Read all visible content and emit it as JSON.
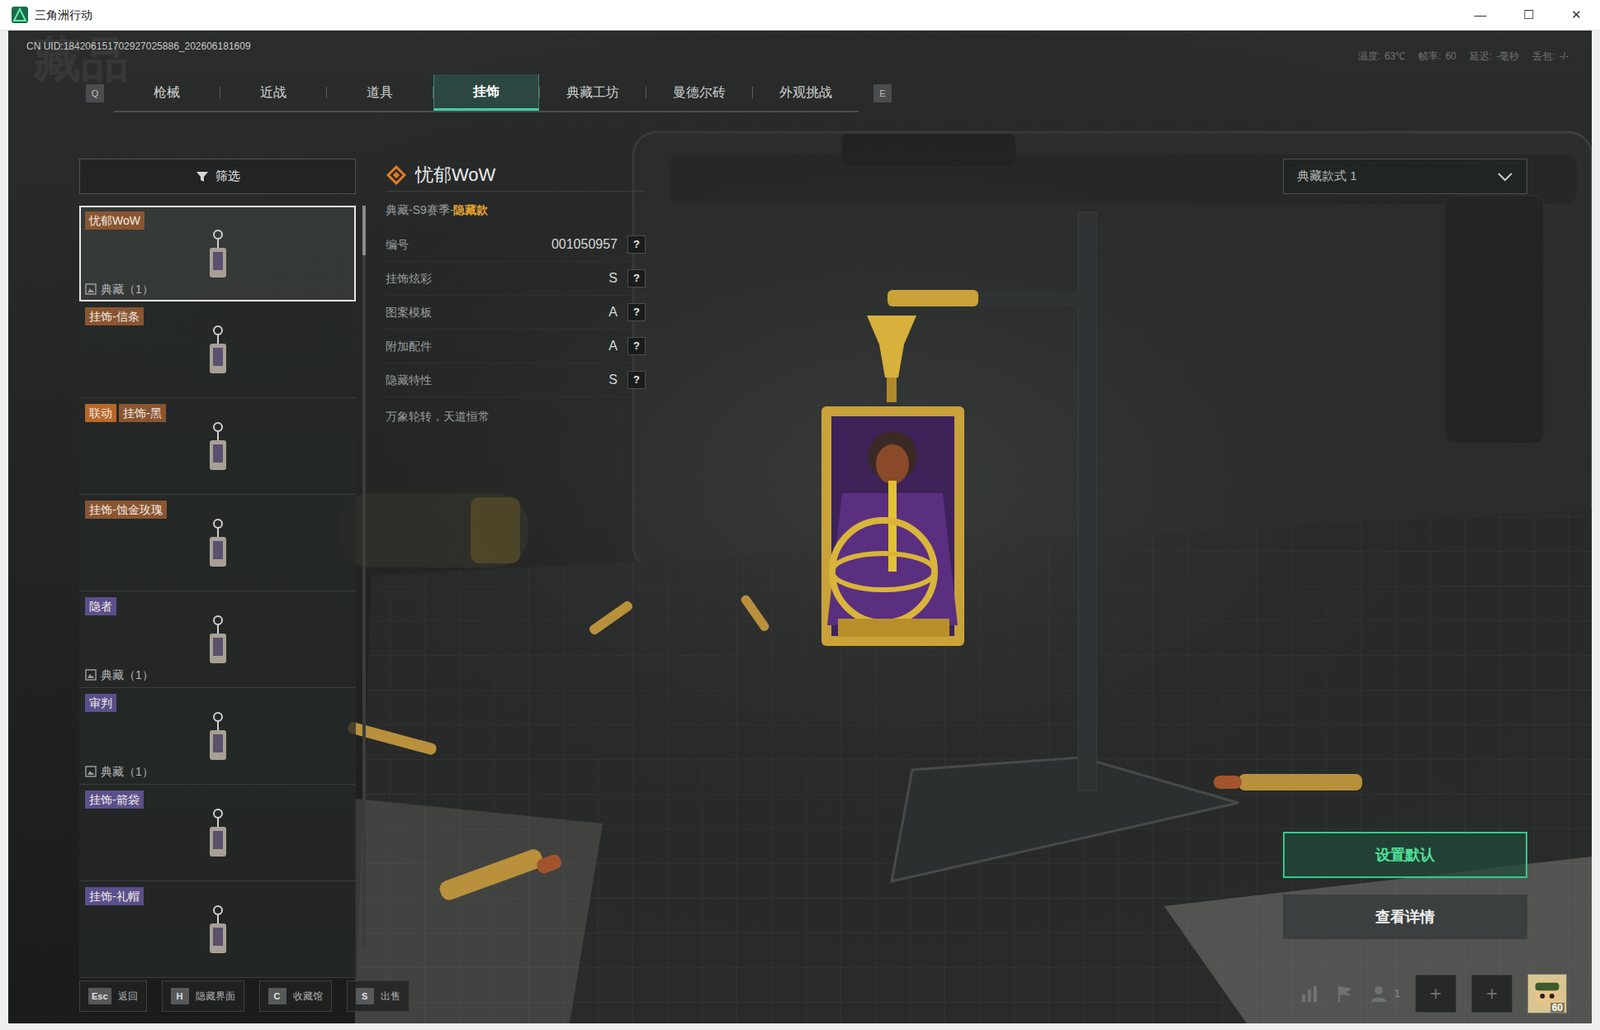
{
  "window": {
    "title": "三角洲行动",
    "controls": [
      "—",
      "☐",
      "✕"
    ]
  },
  "watermark": "藏品",
  "uid": "CN UID:184206151702927025886_202606181609",
  "stats": [
    {
      "label": "温度:",
      "value": "63℃"
    },
    {
      "label": "帧率:",
      "value": "60"
    },
    {
      "label": "延迟:",
      "value": "-毫秒"
    },
    {
      "label": "丢包:",
      "value": "-/-"
    }
  ],
  "tabs": {
    "prev_key": "Q",
    "next_key": "E",
    "items": [
      {
        "label": "枪械",
        "selected": false
      },
      {
        "label": "近战",
        "selected": false
      },
      {
        "label": "道具",
        "selected": false
      },
      {
        "label": "挂饰",
        "selected": true
      },
      {
        "label": "典藏工坊",
        "selected": false
      },
      {
        "label": "曼德尔砖",
        "selected": false
      },
      {
        "label": "外观挑战",
        "selected": false
      }
    ]
  },
  "filter": "筛选",
  "items": [
    {
      "tags": [
        {
          "text": "忧郁WoW",
          "color": "#8a5530"
        }
      ],
      "collection": "典藏（1）",
      "selected": true
    },
    {
      "tags": [
        {
          "text": "挂饰-信条",
          "color": "#8a5530"
        }
      ],
      "selected": false
    },
    {
      "tags": [
        {
          "text": "联动",
          "color": "#b8672a"
        },
        {
          "text": "挂饰-黑",
          "color": "#8a5530"
        }
      ],
      "selected": false
    },
    {
      "tags": [
        {
          "text": "挂饰-蚀金玫瑰",
          "color": "#8a5530"
        }
      ],
      "selected": false
    },
    {
      "tags": [
        {
          "text": "隐者",
          "color": "#5b4f8c"
        }
      ],
      "collection": "典藏（1）",
      "selected": false
    },
    {
      "tags": [
        {
          "text": "审判",
          "color": "#5b4f8c"
        }
      ],
      "collection": "典藏（1）",
      "selected": false
    },
    {
      "tags": [
        {
          "text": "挂饰-箭袋",
          "color": "#5b4f8c"
        }
      ],
      "selected": false
    },
    {
      "tags": [
        {
          "text": "挂饰-礼帽",
          "color": "#5b4f8c"
        }
      ],
      "selected": false
    }
  ],
  "detail": {
    "title": "忧郁WoW",
    "subtitle": "典藏-S9赛季-",
    "subtitle_highlight": "隐藏款",
    "rows": [
      {
        "label": "编号",
        "value": "001050957",
        "help": "?"
      },
      {
        "label": "挂饰炫彩",
        "value": "S",
        "help": "?"
      },
      {
        "label": "图案模板",
        "value": "A",
        "help": "?"
      },
      {
        "label": "附加配件",
        "value": "A",
        "help": "?"
      },
      {
        "label": "隐藏特性",
        "value": "S",
        "help": "?"
      }
    ],
    "description": "万象轮转，天道恒常"
  },
  "style_select": {
    "value": "典藏款式 1"
  },
  "buttons": [
    {
      "label": "设置默认",
      "primary": true
    },
    {
      "label": "查看详情",
      "primary": false
    }
  ],
  "hotkeys": [
    {
      "key": "Esc",
      "label": "返回"
    },
    {
      "key": "H",
      "label": "隐藏界面"
    },
    {
      "key": "C",
      "label": "收藏馆"
    },
    {
      "key": "S",
      "label": "出售"
    }
  ],
  "social": {
    "friends": "1"
  },
  "slots": [
    "+",
    "+"
  ],
  "player": {
    "level": "60"
  }
}
